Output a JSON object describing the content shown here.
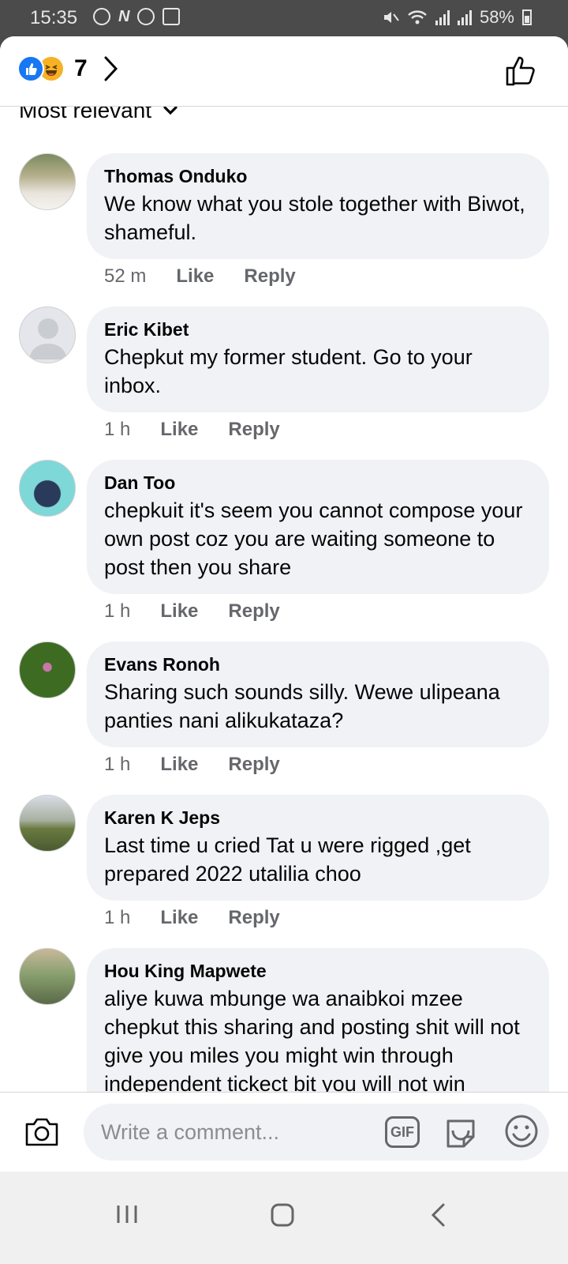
{
  "status_bar": {
    "time": "15:35",
    "notif_n": "N",
    "battery": "58%"
  },
  "header": {
    "reaction_count": "7",
    "like_color": "#1877f2",
    "haha_color": "#f7b125"
  },
  "sort": {
    "label": "Most relevant"
  },
  "comments": [
    {
      "author": "Thomas Onduko",
      "text": "We know what you stole together with Biwot, shameful.",
      "time": "52 m",
      "like": "Like",
      "reply": "Reply"
    },
    {
      "author": "Eric Kibet",
      "text": "Chepkut my former student.  Go to  your inbox.",
      "time": "1 h",
      "like": "Like",
      "reply": "Reply"
    },
    {
      "author": "Dan Too",
      "text": "chepkuit it's seem you cannot compose your own post coz you are waiting someone to post then you share",
      "time": "1 h",
      "like": "Like",
      "reply": "Reply"
    },
    {
      "author": "Evans Ronoh",
      "text": "Sharing such sounds silly. Wewe ulipeana panties nani alikukataza?",
      "time": "1 h",
      "like": "Like",
      "reply": "Reply"
    },
    {
      "author": "Karen K Jeps",
      "text": "Last time u cried Tat u were rigged ,get prepared 2022 utalilia choo",
      "time": "1 h",
      "like": "Like",
      "reply": "Reply"
    },
    {
      "author": "Hou King Mapwete",
      "text": "aliye kuwa mbunge wa anaibkoi mzee chepkut this sharing and posting shit will not give you miles you might win through independent tickect bit you will not win",
      "time": "",
      "like": "",
      "reply": ""
    }
  ],
  "composer": {
    "placeholder": "Write a comment...",
    "gif_label": "GIF"
  }
}
